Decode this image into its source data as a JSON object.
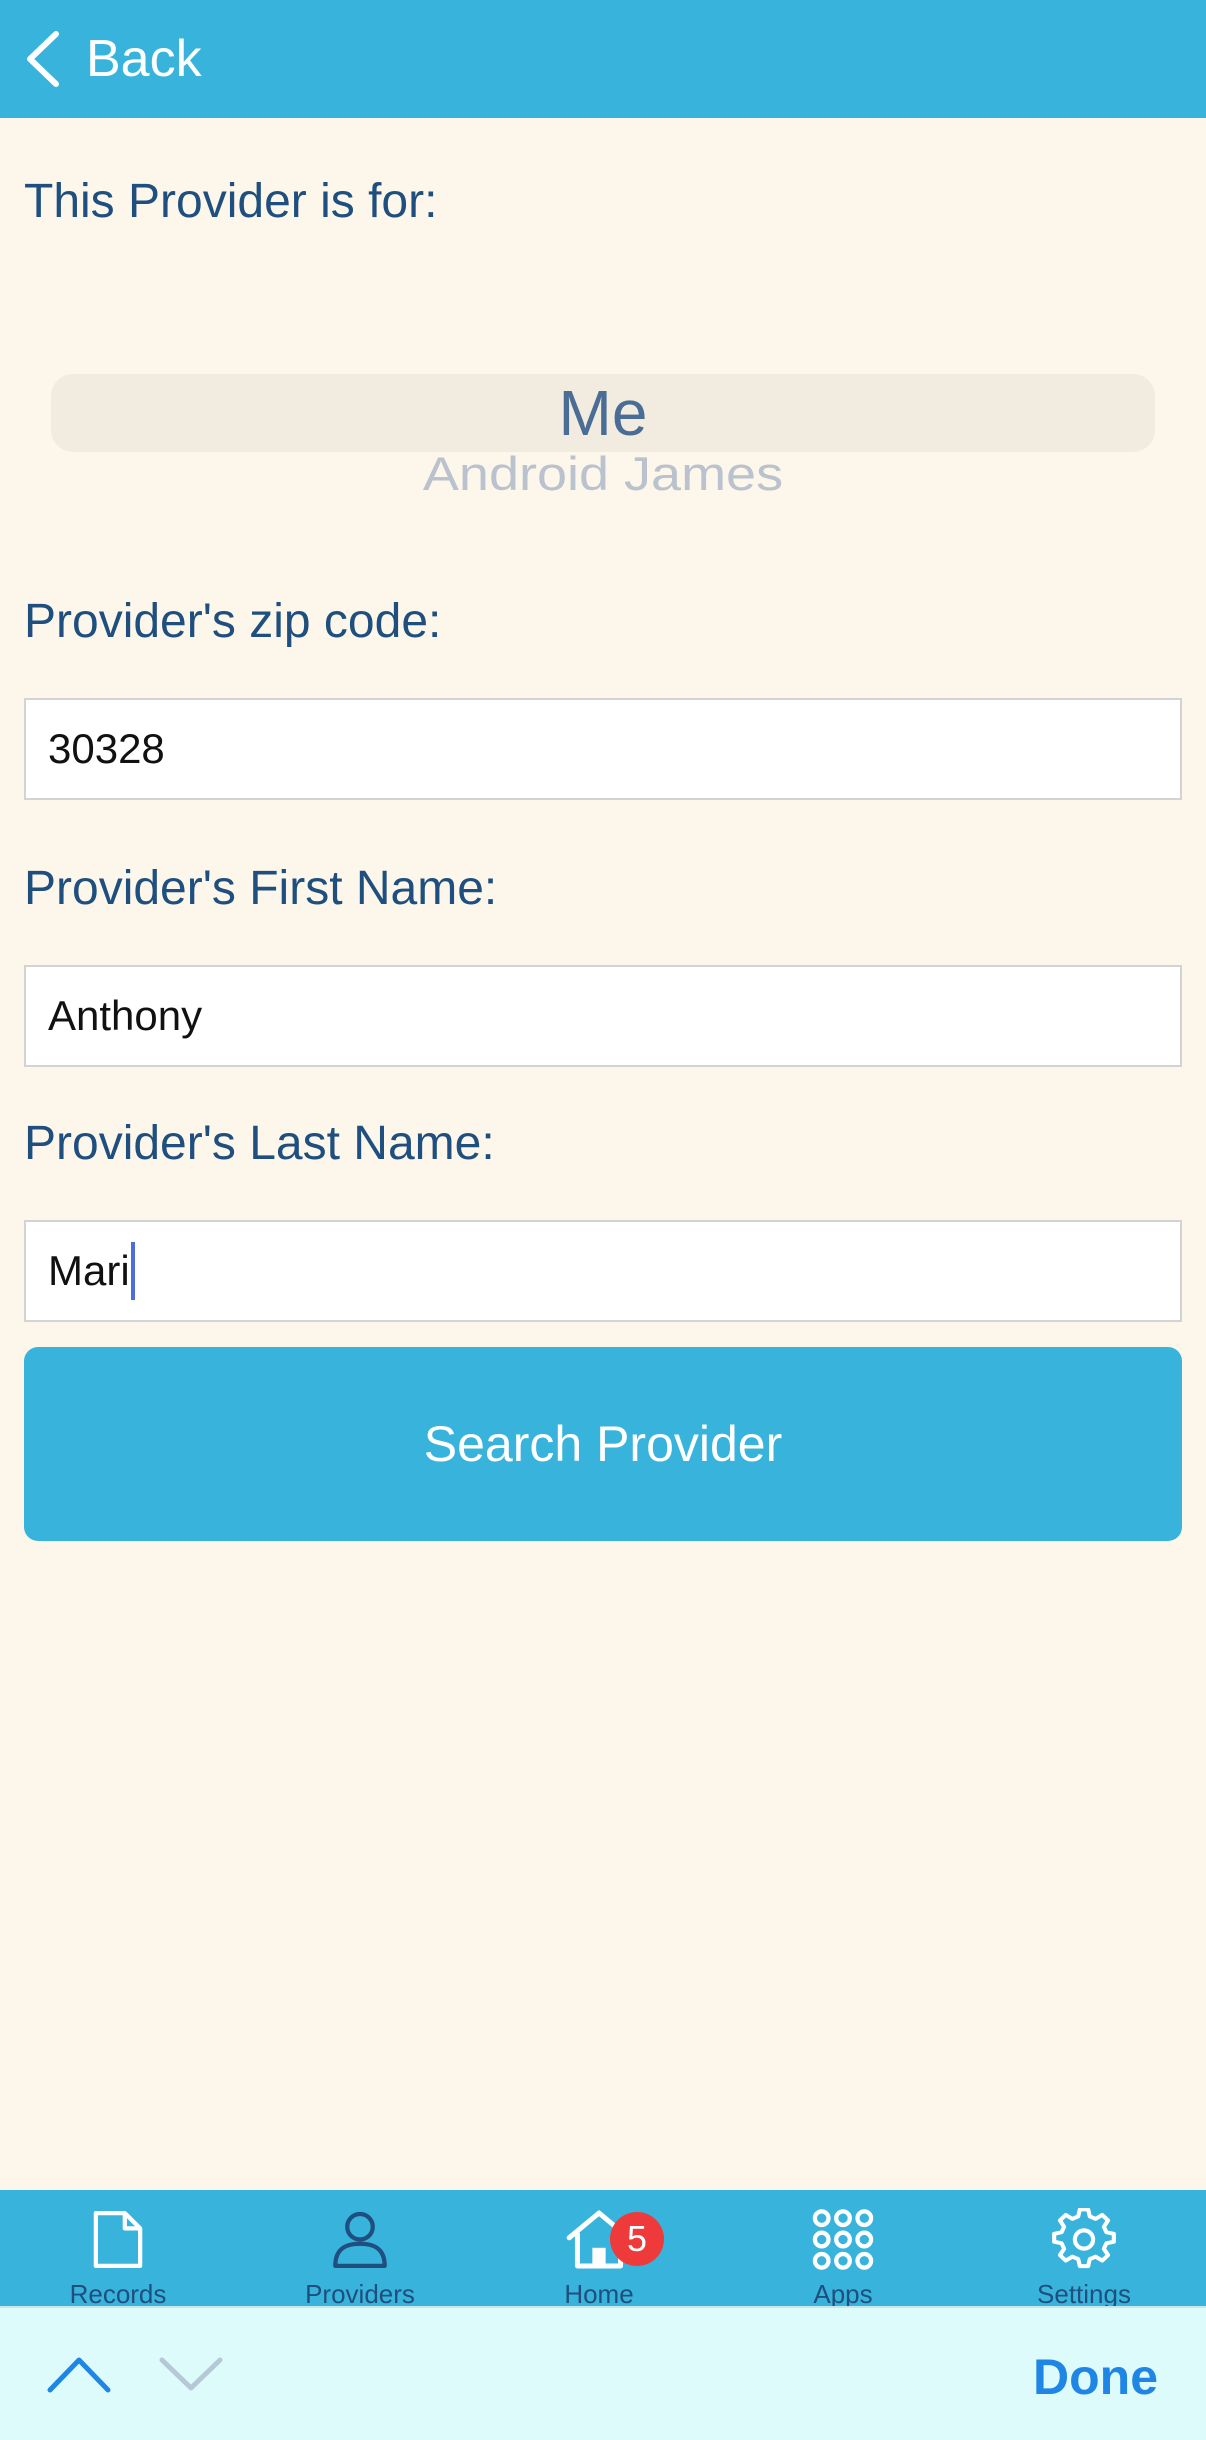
{
  "nav": {
    "back_label": "Back"
  },
  "form": {
    "for_label": "This Provider is for:",
    "picker": {
      "selected": "Me",
      "next_option": "Android James"
    },
    "zip_label": "Provider's zip code:",
    "zip_value": "30328",
    "first_name_label": "Provider's First Name:",
    "first_name_value": "Anthony",
    "last_name_label": "Provider's Last Name:",
    "last_name_value": "Mari",
    "search_button": "Search Provider"
  },
  "tab_bar": {
    "tabs": [
      {
        "icon": "document-icon",
        "label": "Records"
      },
      {
        "icon": "person-icon",
        "label": "Providers"
      },
      {
        "icon": "home-icon",
        "label": "Home",
        "badge": "5"
      },
      {
        "icon": "grid-icon",
        "label": "Apps"
      },
      {
        "icon": "gear-icon",
        "label": "Settings"
      }
    ]
  },
  "keyboard_toolbar": {
    "done_label": "Done"
  },
  "colors": {
    "header": "#38b4dc",
    "background": "#fdf6ea",
    "label_text": "#1e4f7e",
    "badge": "#ee3a3a",
    "done": "#1f86e6"
  }
}
